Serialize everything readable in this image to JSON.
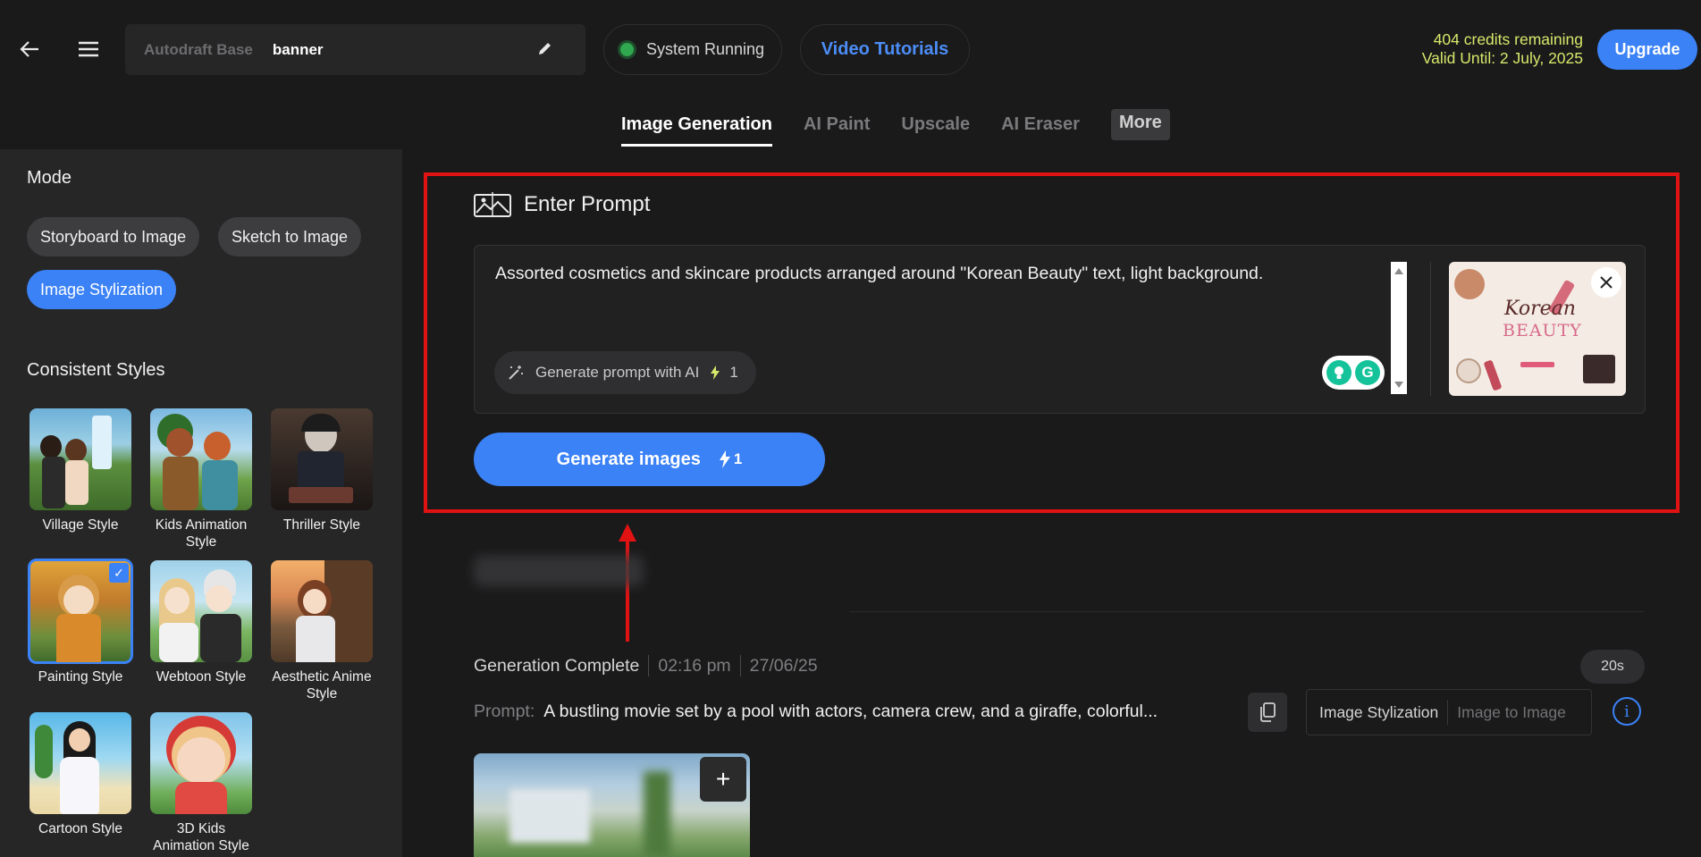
{
  "header": {
    "project_base": "Autodraft Base",
    "project_name": "banner",
    "status": "System Running",
    "tutorials": "Video Tutorials",
    "credits_line1": "404 credits remaining",
    "credits_line2": "Valid Until: 2 July, 2025",
    "upgrade": "Upgrade"
  },
  "tabs": [
    "Image Generation",
    "AI Paint",
    "Upscale",
    "AI Eraser",
    "More"
  ],
  "sidebar": {
    "mode_title": "Mode",
    "modes": [
      "Storyboard to Image",
      "Sketch to Image",
      "Image Stylization"
    ],
    "styles_title": "Consistent Styles",
    "styles": [
      "Village Style",
      "Kids Animation Style",
      "Thriller Style",
      "Painting Style",
      "Webtoon Style",
      "Aesthetic Anime Style",
      "Cartoon Style",
      "3D Kids Animation Style"
    ],
    "selected_style": "Painting Style"
  },
  "prompt": {
    "title": "Enter Prompt",
    "text": "Assorted cosmetics and skincare products arranged around \"Korean Beauty\" text, light background.",
    "gen_ai_label": "Generate prompt with AI",
    "gen_ai_cost": "1",
    "ref_image_text_1": "Korean",
    "ref_image_text_2": "BEAUTY"
  },
  "generate": {
    "label": "Generate images",
    "cost": "1"
  },
  "result": {
    "status": "Generation Complete",
    "time": "02:16 pm",
    "date": "27/06/25",
    "duration": "20s",
    "prompt_label": "Prompt:",
    "prompt_text": "A bustling movie set by a pool with actors, camera crew, and a giraffe, colorful...",
    "mode_tag_1": "Image Stylization",
    "mode_tag_2": "Image to Image"
  },
  "colors": {
    "accent": "#3b82f6",
    "credits": "#d8e86a",
    "highlight": "#e11212",
    "status": "#2fa84f"
  }
}
